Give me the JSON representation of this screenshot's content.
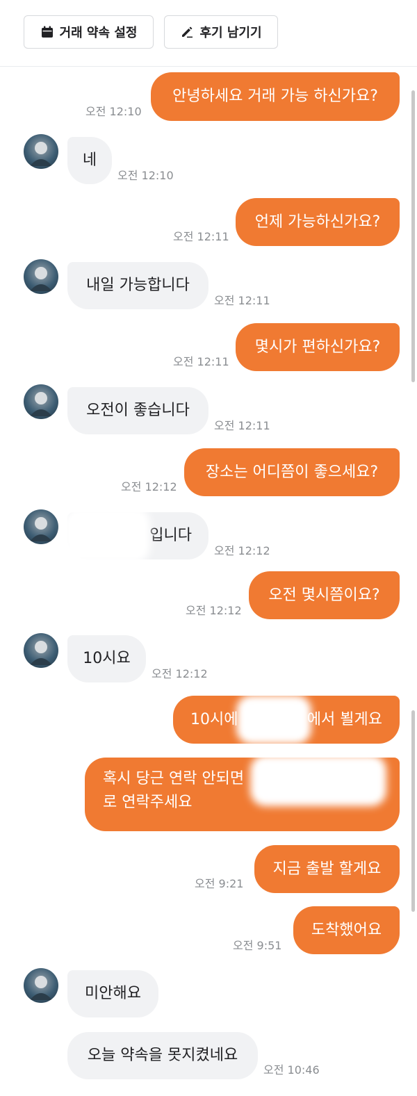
{
  "header": {
    "schedule_button": "거래 약속 설정",
    "review_button": "후기 남기기"
  },
  "icons": {
    "schedule": "calendar-icon",
    "review": "pencil-icon"
  },
  "colors": {
    "outgoing_bubble": "#f07a32",
    "incoming_bubble": "#f1f2f4",
    "timestamp": "#8a8d91"
  },
  "messages": [
    {
      "sender": "me",
      "text": "안녕하세요 거래 가능 하신가요?",
      "time": "오전 12:10"
    },
    {
      "sender": "other",
      "text": "네",
      "time": "오전 12:10"
    },
    {
      "sender": "me",
      "text": "언제 가능하신가요?",
      "time": "오전 12:11"
    },
    {
      "sender": "other",
      "text": "내일 가능합니다",
      "time": "오전 12:11"
    },
    {
      "sender": "me",
      "text": "몇시가 편하신가요?",
      "time": "오전 12:11"
    },
    {
      "sender": "other",
      "text": "오전이 좋습니다",
      "time": "오전 12:11"
    },
    {
      "sender": "me",
      "text": "장소는 어디쯤이 좋으세요?",
      "time": "오전 12:12"
    },
    {
      "sender": "other",
      "text": "입니다",
      "time": "오전 12:12"
    },
    {
      "sender": "me",
      "text": "오전 몇시쯤이요?",
      "time": "오전 12:12"
    },
    {
      "sender": "other",
      "text": "10시요",
      "time": "오전 12:12"
    },
    {
      "sender": "me",
      "text_before": "10시에",
      "text_after": "에서 뵐게요"
    },
    {
      "sender": "me",
      "line1": "혹시 당근 연락 안되면",
      "line2": "로 연락주세요"
    },
    {
      "sender": "me",
      "text": "지금 출발 할게요",
      "time": "오전 9:21"
    },
    {
      "sender": "me",
      "text": "도착했어요",
      "time": "오전 9:51"
    },
    {
      "sender": "other",
      "text": "미안해요"
    },
    {
      "sender": "other",
      "text": "오늘 약속을 못지켰네요",
      "time": "오전 10:46"
    }
  ]
}
